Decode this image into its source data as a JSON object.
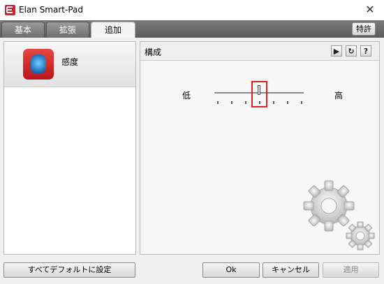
{
  "window": {
    "title": "Elan Smart-Pad",
    "close_label": "✕"
  },
  "tabs": [
    {
      "label": "基本"
    },
    {
      "label": "拡張"
    },
    {
      "label": "追加"
    }
  ],
  "help_button": "特許",
  "left_list": {
    "items": [
      {
        "label": "感度"
      }
    ]
  },
  "config": {
    "title": "構成",
    "toolbar": {
      "play": "▶",
      "refresh": "↻",
      "help": "?"
    },
    "slider": {
      "low_label": "低",
      "high_label": "高",
      "value_fraction": 0.5,
      "tick_count": 7
    }
  },
  "buttons": {
    "reset": "すべてデフォルトに設定",
    "ok": "Ok",
    "cancel": "キャンセル",
    "apply": "適用"
  },
  "colors": {
    "accent": "#e02020",
    "icon_red": "#d4202a",
    "tabbar": "#6a6a6a"
  }
}
